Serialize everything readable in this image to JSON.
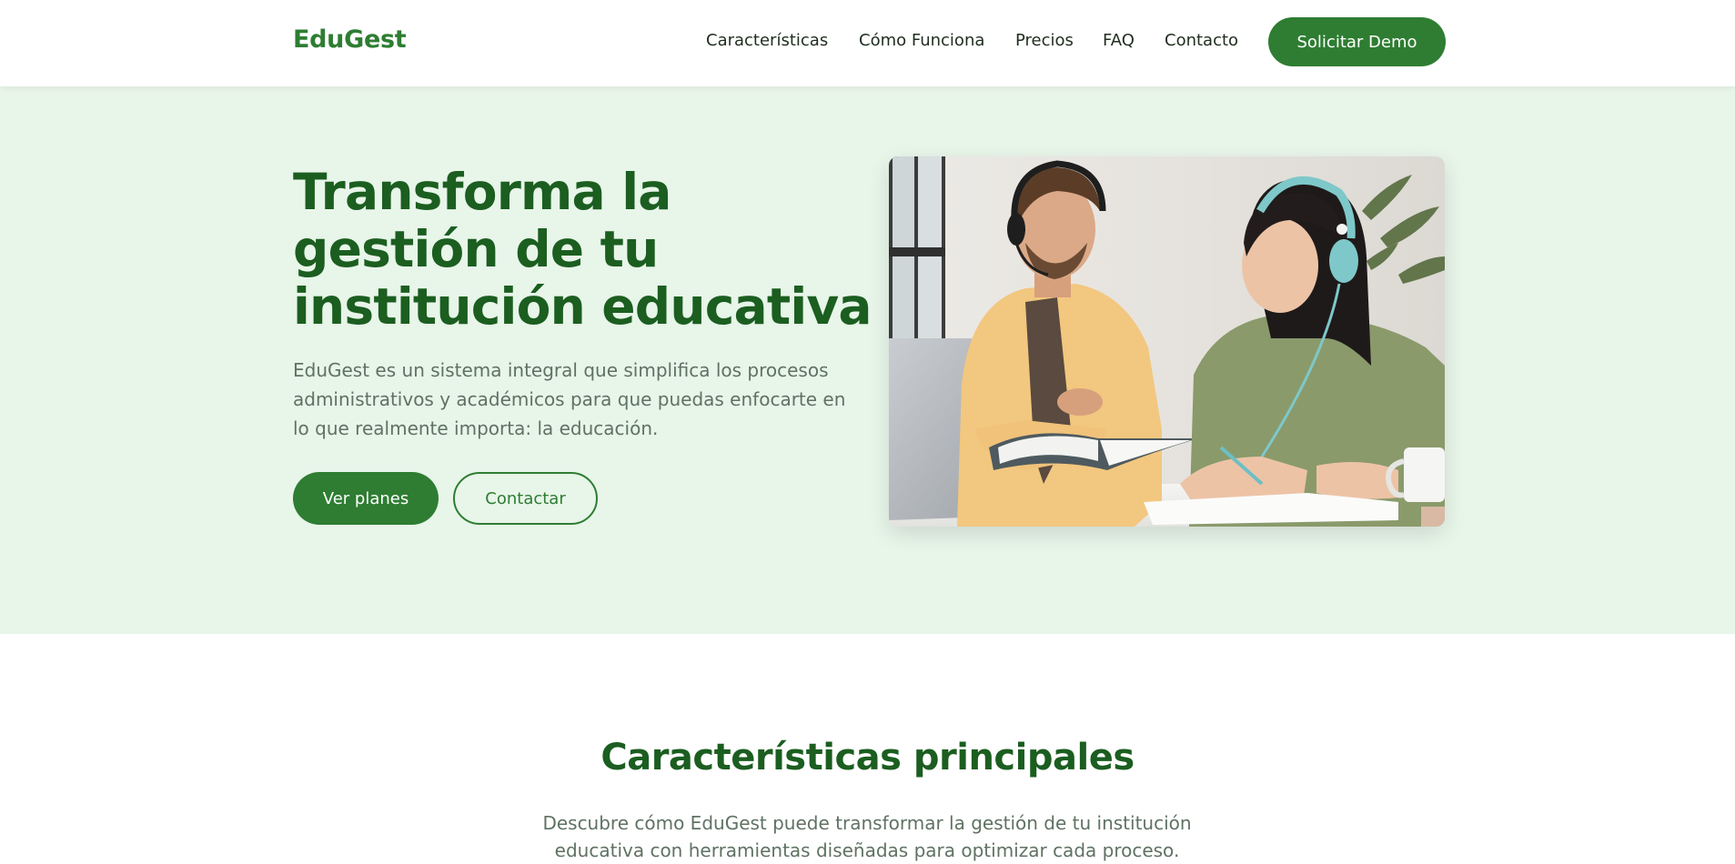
{
  "brand": {
    "name": "EduGest",
    "primary_color": "#2e7d32",
    "heading_color": "#1b5e20",
    "hero_bg_color": "#e8f5e9"
  },
  "nav": {
    "links": [
      "Características",
      "Cómo Funciona",
      "Precios",
      "FAQ",
      "Contacto"
    ],
    "cta_label": "Solicitar Demo"
  },
  "hero": {
    "title": "Transforma la gestión de tu institución educativa",
    "description": "EduGest es un sistema integral que simplifica los procesos administrativos y académicos para que puedas enfocarte en lo que realmente importa: la educación.",
    "primary_button": "Ver planes",
    "secondary_button": "Contactar",
    "image": "photo-two-people-studying-with-headphones"
  },
  "features": {
    "title": "Características principales",
    "description": "Descubre cómo EduGest puede transformar la gestión de tu institución educativa con herramientas diseñadas para optimizar cada proceso."
  }
}
